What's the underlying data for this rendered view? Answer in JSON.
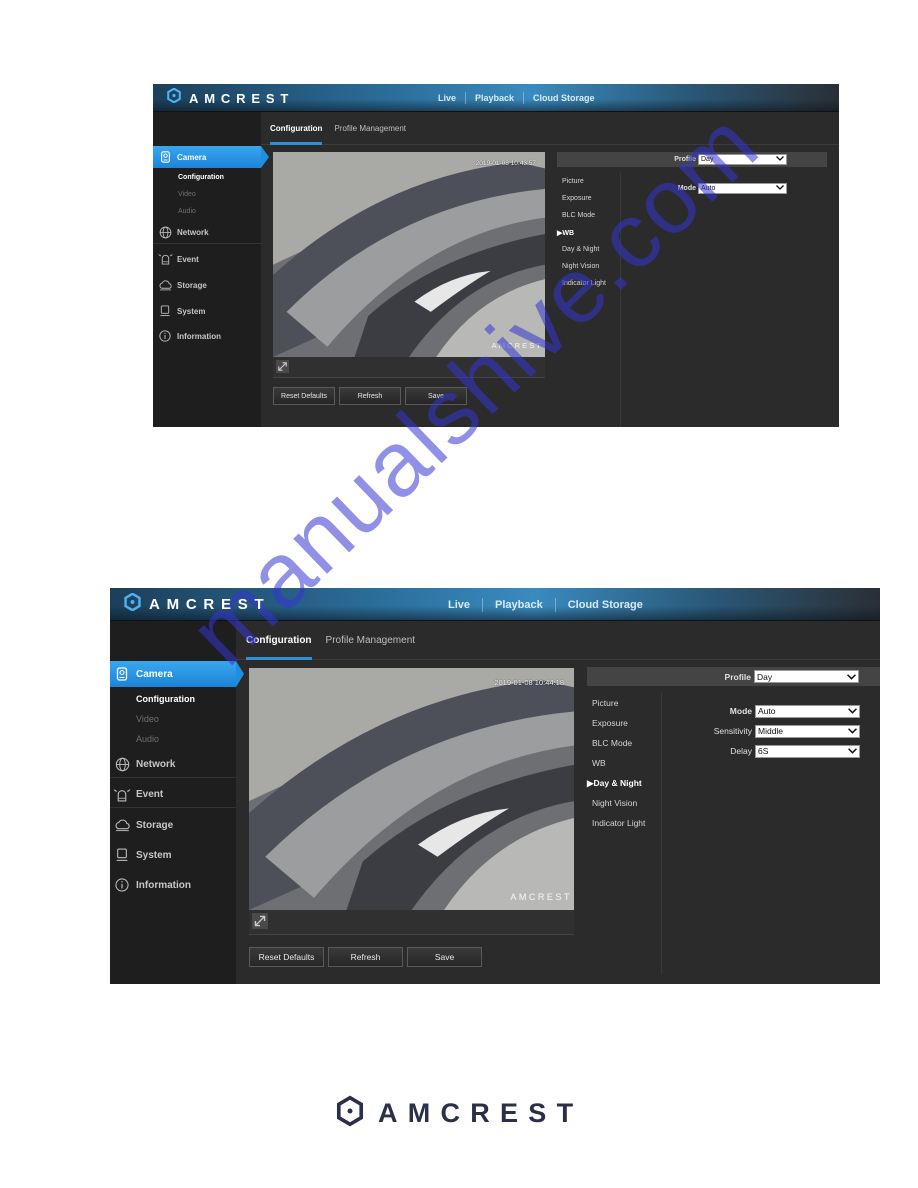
{
  "brand": {
    "name": "AMCREST",
    "accent": "#2f8fd8",
    "active_nav": "#1b84d8"
  },
  "screenshots": [
    {
      "topnav": [
        "Live",
        "Playback",
        "Cloud Storage"
      ],
      "sidebar": {
        "items": [
          {
            "label": "Camera",
            "icon": "camera-icon"
          },
          {
            "label": "Network",
            "icon": "network-globe-icon"
          },
          {
            "label": "Event",
            "icon": "alarm-icon"
          },
          {
            "label": "Storage",
            "icon": "cloud-icon"
          },
          {
            "label": "System",
            "icon": "monitor-icon"
          },
          {
            "label": "Information",
            "icon": "info-icon"
          }
        ],
        "sub_items": [
          "Configuration",
          "Video",
          "Audio"
        ],
        "active_item": "Camera",
        "active_sub": "Configuration"
      },
      "tabs": [
        "Configuration",
        "Profile Management"
      ],
      "active_tab": "Configuration",
      "video": {
        "timestamp": "2019-01-08 10:43:57",
        "watermark": "AMCREST"
      },
      "buttons": {
        "reset": "Reset Defaults",
        "refresh": "Refresh",
        "save": "Save"
      },
      "profile": {
        "label": "Profile",
        "value": "Day"
      },
      "settings_menu": [
        "Picture",
        "Exposure",
        "BLC Mode",
        "WB",
        "Day & Night",
        "Night Vision",
        "Indicator Light"
      ],
      "active_setting": "WB",
      "fields": [
        {
          "label": "Mode",
          "value": "Auto"
        }
      ]
    },
    {
      "topnav": [
        "Live",
        "Playback",
        "Cloud Storage"
      ],
      "sidebar": {
        "items": [
          {
            "label": "Camera",
            "icon": "camera-icon"
          },
          {
            "label": "Network",
            "icon": "network-globe-icon"
          },
          {
            "label": "Event",
            "icon": "alarm-icon"
          },
          {
            "label": "Storage",
            "icon": "cloud-icon"
          },
          {
            "label": "System",
            "icon": "monitor-icon"
          },
          {
            "label": "Information",
            "icon": "info-icon"
          }
        ],
        "sub_items": [
          "Configuration",
          "Video",
          "Audio"
        ],
        "active_item": "Camera",
        "active_sub": "Configuration"
      },
      "tabs": [
        "Configuration",
        "Profile Management"
      ],
      "active_tab": "Configuration",
      "video": {
        "timestamp": "2019-01-08 10:44:18",
        "watermark": "AMCREST"
      },
      "buttons": {
        "reset": "Reset Defaults",
        "refresh": "Refresh",
        "save": "Save"
      },
      "profile": {
        "label": "Profile",
        "value": "Day"
      },
      "settings_menu": [
        "Picture",
        "Exposure",
        "BLC Mode",
        "WB",
        "Day & Night",
        "Night Vision",
        "Indicator Light"
      ],
      "active_setting": "Day & Night",
      "fields": [
        {
          "label": "Mode",
          "value": "Auto"
        },
        {
          "label": "Sensitivity",
          "value": "Middle"
        },
        {
          "label": "Delay",
          "value": "6S"
        }
      ]
    }
  ],
  "footer": {
    "brand": "AMCREST"
  },
  "page_watermark": "manualshive.com",
  "active_marker": "▶"
}
